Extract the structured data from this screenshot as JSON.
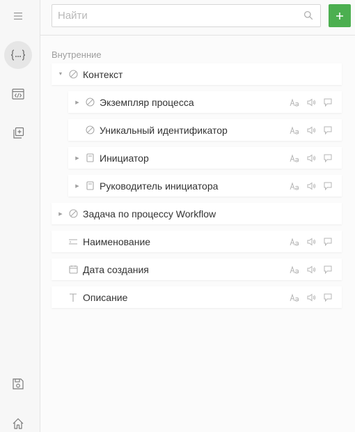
{
  "search": {
    "placeholder": "Найти"
  },
  "add_button": {
    "label": "+"
  },
  "colors": {
    "accent": "#4caf50",
    "rail_bg": "#f7f7f7",
    "row_bg": "#ffffff"
  },
  "rail": {
    "top_items": [
      {
        "name": "context-variables-icon",
        "active": true
      },
      {
        "name": "code-window-icon",
        "active": false
      },
      {
        "name": "add-copy-icon",
        "active": false
      }
    ],
    "bottom_items": [
      {
        "name": "save-icon"
      },
      {
        "name": "home-icon"
      }
    ],
    "menu_icon": "menu-icon"
  },
  "section": {
    "title": "Внутренние"
  },
  "tree": [
    {
      "label": "Контекст",
      "icon": "slash-circle-icon",
      "caret": "expanded",
      "level": 0,
      "actions": false
    },
    {
      "label": "Экземпляр процесса",
      "icon": "slash-circle-icon",
      "caret": "collapsed",
      "level": 1,
      "actions": true
    },
    {
      "label": "Уникальный идентификатор",
      "icon": "slash-circle-icon",
      "caret": "none",
      "level": 1,
      "actions": true
    },
    {
      "label": "Инициатор",
      "icon": "user-card-icon",
      "caret": "collapsed",
      "level": 1,
      "actions": true
    },
    {
      "label": "Руководитель инициатора",
      "icon": "user-card-icon",
      "caret": "collapsed",
      "level": 1,
      "actions": true
    },
    {
      "label": "Задача по процессу Workflow",
      "icon": "slash-circle-icon",
      "caret": "collapsed",
      "level": 0,
      "actions": false
    },
    {
      "label": "Наименование",
      "icon": "text-field-icon",
      "caret": "none",
      "level": 0,
      "actions": true
    },
    {
      "label": "Дата создания",
      "icon": "calendar-icon",
      "caret": "none",
      "level": 0,
      "actions": true
    },
    {
      "label": "Описание",
      "icon": "text-t-icon",
      "caret": "none",
      "level": 0,
      "actions": true
    }
  ],
  "row_actions": [
    "font-size-icon",
    "speaker-icon",
    "comment-icon"
  ]
}
